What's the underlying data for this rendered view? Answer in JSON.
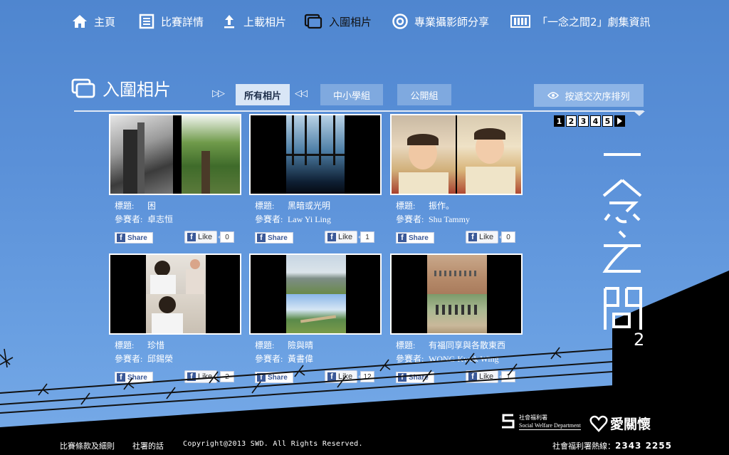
{
  "nav": {
    "items": [
      {
        "label": "主頁",
        "icon": "home-icon"
      },
      {
        "label": "比賽詳情",
        "icon": "document-icon"
      },
      {
        "label": "上載相片",
        "icon": "upload-icon"
      },
      {
        "label": "入圍相片",
        "icon": "gallery-icon",
        "active": true
      },
      {
        "label": "專業攝影師分享",
        "icon": "target-icon"
      },
      {
        "label": "「一念之間2」劇集資訊",
        "icon": "film-strip-icon"
      }
    ]
  },
  "section": {
    "title": "入圍相片",
    "filters": [
      "所有相片",
      "中小學組",
      "公開組"
    ],
    "active_filter": "所有相片",
    "sort_label": "按遞交次序排列"
  },
  "pagination": {
    "pages": [
      "1",
      "2",
      "3",
      "4",
      "5"
    ],
    "current": "1"
  },
  "labels": {
    "title_key": "標題:",
    "author_key": "參賽者:",
    "share": "Share",
    "like": "Like"
  },
  "entries": [
    {
      "title": "困",
      "author": "卓志恒",
      "likes": "0"
    },
    {
      "title": "黑暗或光明",
      "author": "Law Yi Ling",
      "likes": "1"
    },
    {
      "title": "振作。",
      "author": "Shu Tammy",
      "likes": "0"
    },
    {
      "title": "珍惜",
      "author": "邱錫榮",
      "likes": "2"
    },
    {
      "title": "險與晴",
      "author": "黃書偉",
      "likes": "12"
    },
    {
      "title": "有福同享與各散東西",
      "author": "WONG Kwok Wing",
      "likes": "1"
    }
  ],
  "series_logo": {
    "text": "一念之間",
    "number": "2"
  },
  "footer": {
    "terms": "比賽條款及細則",
    "director": "社署的話",
    "copyright": "Copyright@2013 SWD. All Rights Reserved.",
    "hotline_label": "社會福利署熱線：",
    "hotline_number": "2343 2255"
  },
  "swd": {
    "zh": "社會福利署",
    "en": "Social Welfare Department"
  },
  "care": {
    "label": "愛關懷"
  }
}
